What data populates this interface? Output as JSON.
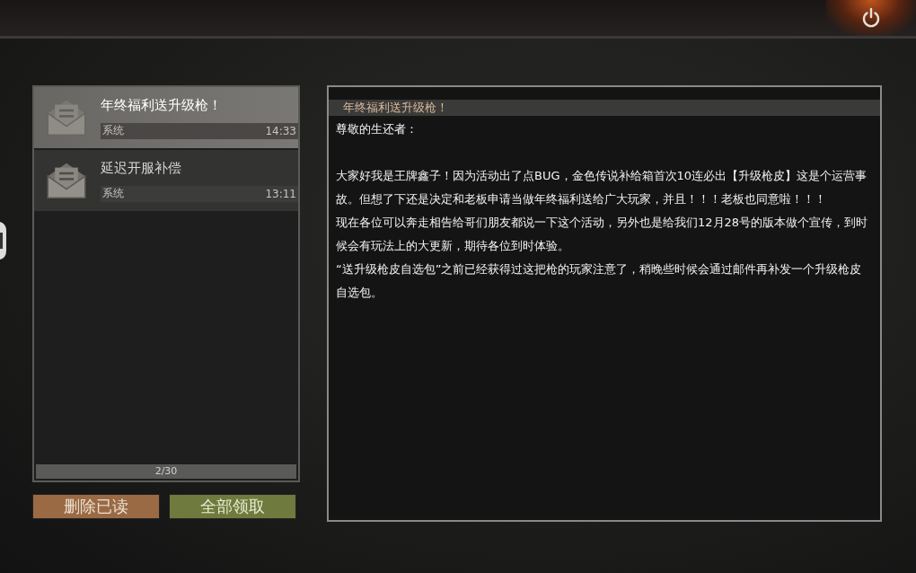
{
  "mail_list": {
    "items": [
      {
        "title": "年终福利送升级枪！",
        "sender": "系统",
        "time": "14:33",
        "selected": true
      },
      {
        "title": "延迟开服补偿",
        "sender": "系统",
        "time": "13:11",
        "selected": false
      }
    ],
    "counter": "2/30"
  },
  "buttons": [
    {
      "label": "删除已读",
      "kind": "delete"
    },
    {
      "label": "全部领取",
      "kind": "claim"
    }
  ],
  "message": {
    "title": "年终福利送升级枪！",
    "greeting": "尊敬的生还者：",
    "paragraphs": [
      "大家好我是王牌鑫子！因为活动出了点BUG，金色传说补给箱首次10连必出【升级枪皮】这是个运营事故。但想了下还是决定和老板申请当做年终福利送给广大玩家，并且！！！老板也同意啦！！！",
      "现在各位可以奔走相告给哥们朋友都说一下这个活动，另外也是给我们12月28号的版本做个宣传，到时候会有玩法上的大更新，期待各位到时体验。",
      "“送升级枪皮自选包”之前已经获得过这把枪的玩家注意了，稍晚些时候会通过邮件再补发一个升级枪皮自选包。"
    ]
  }
}
